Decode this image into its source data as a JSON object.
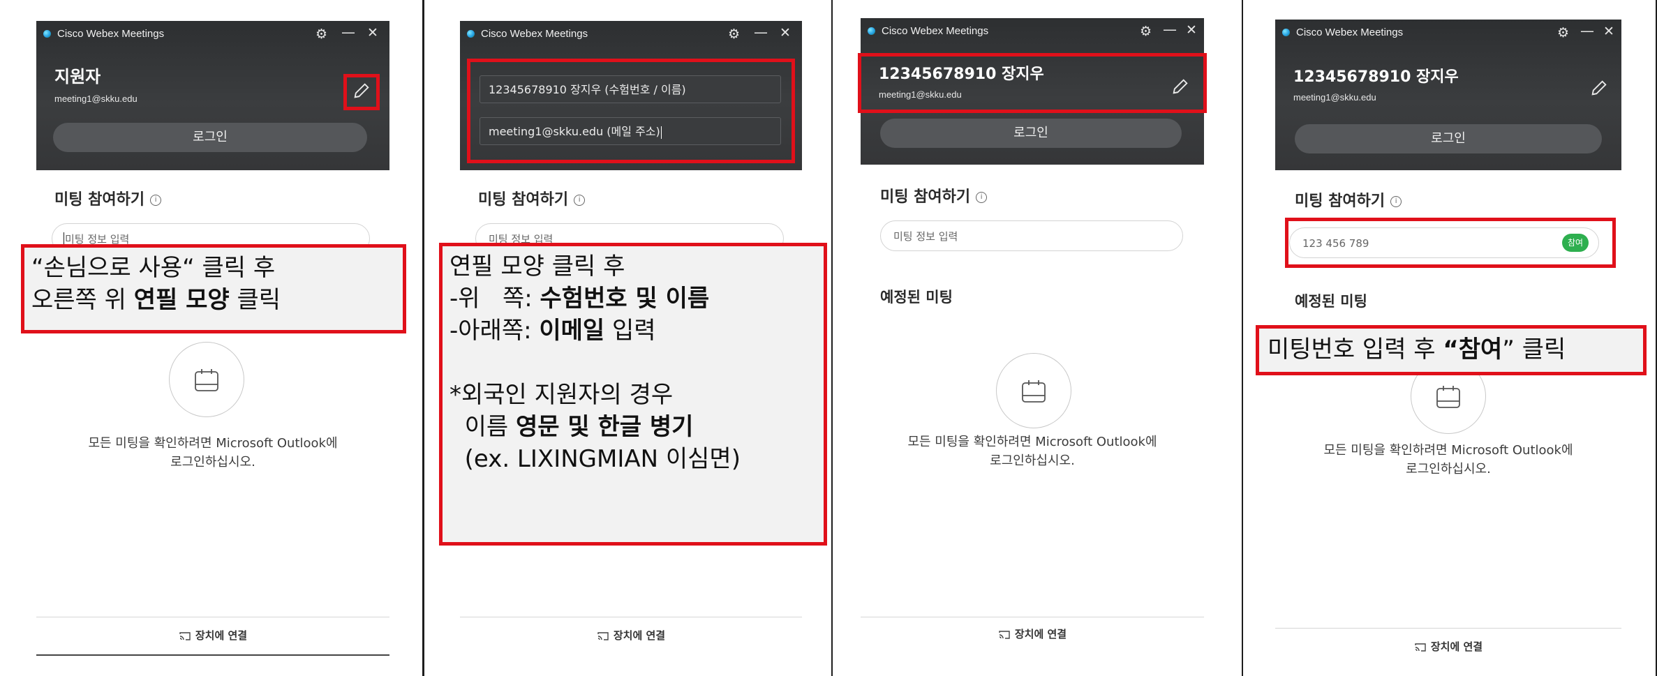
{
  "app": {
    "title": "Cisco Webex Meetings",
    "login_label": "로그인",
    "join_title": "미팅 참여하기",
    "info_symbol": "i",
    "join_placeholder": "미팅 정보 입력",
    "scheduled_title": "예정된 미팅",
    "empty_line1": "모든 미팅을 확인하려면 Microsoft Outlook에",
    "empty_line2": "로그인하십시오.",
    "connect_device": "장치에 연결",
    "gear_icon": "gear-icon",
    "minimize_symbol": "—",
    "close_symbol": "✕"
  },
  "panel1": {
    "user_name": "지원자",
    "user_email": "meeting1@skku.edu",
    "callout_line1": "“손님으로 사용“ 클릭 후",
    "callout_line2_pre": "오른쪽 위 ",
    "callout_line2_bold": "연필 모양",
    "callout_line2_post": " 클릭"
  },
  "panel2": {
    "name_input_value": "12345678910 장지우 (수험번호 / 이름)",
    "email_input_value": "meeting1@skku.edu (메일 주소)",
    "c1": "연필 모양 클릭 후",
    "c2_pre": "-위   쪽: ",
    "c2_bold": "수험번호 및 이름",
    "c3_pre": "-아래쪽: ",
    "c3_bold": "이메일",
    "c3_post": " 입력",
    "c4": "*외국인 지원자의 경우",
    "c5_pre": "  이름 ",
    "c5_bold": "영문 및 한글 병기",
    "c6": "  (ex. LIXINGMIAN 이심면)"
  },
  "panel3": {
    "user_name": "12345678910 장지우",
    "user_email": "meeting1@skku.edu"
  },
  "panel4": {
    "user_name": "12345678910 장지우",
    "user_email": "meeting1@skku.edu",
    "meeting_number": "123 456 789",
    "join_button": "참여",
    "callout_pre": "미팅번호 입력 후 ",
    "callout_bold": "“참여",
    "callout_post": "” 클릭"
  }
}
